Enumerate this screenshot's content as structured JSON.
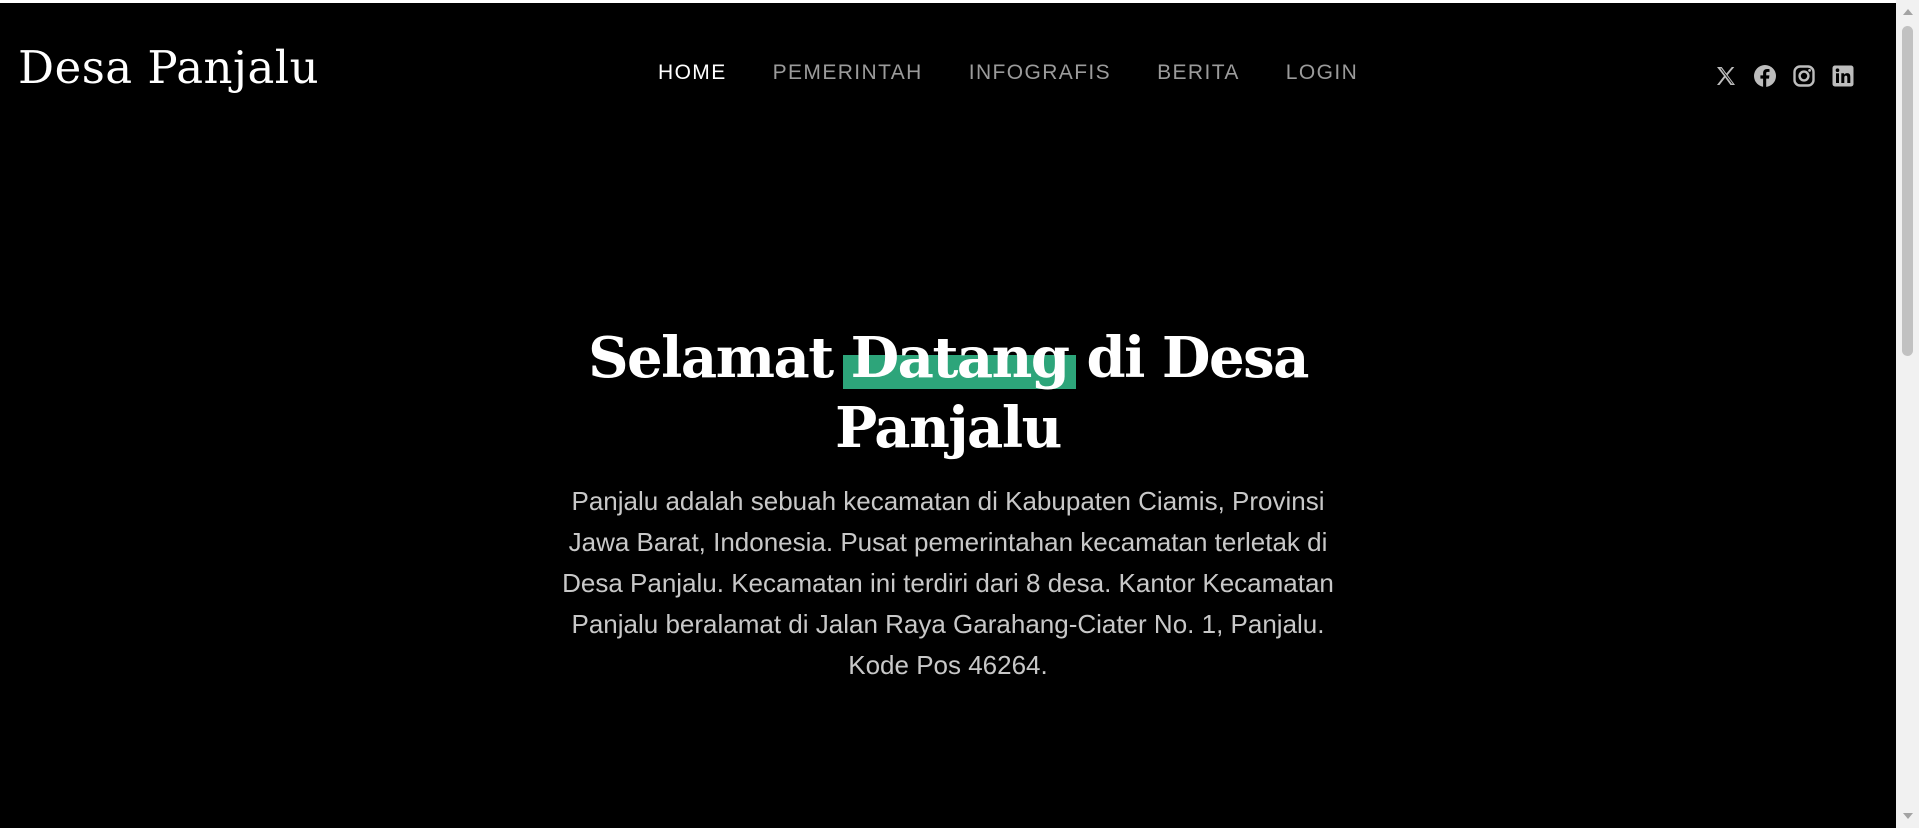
{
  "header": {
    "logo": "Desa Panjalu",
    "nav": [
      {
        "label": "HOME",
        "active": true
      },
      {
        "label": "PEMERINTAH",
        "active": false
      },
      {
        "label": "INFOGRAFIS",
        "active": false
      },
      {
        "label": "BERITA",
        "active": false
      },
      {
        "label": "LOGIN",
        "active": false
      }
    ],
    "socials": [
      "x-icon",
      "facebook-icon",
      "instagram-icon",
      "linkedin-icon"
    ]
  },
  "hero": {
    "title_before": "Selamat",
    "title_highlight": "Datang",
    "title_after": "di Desa Panjalu",
    "description": "Panjalu adalah sebuah kecamatan di Kabupaten Ciamis, Provinsi Jawa Barat, Indonesia. Pusat pemerintahan kecamatan terletak di Desa Panjalu. Kecamatan ini terdiri dari 8 desa. Kantor Kecamatan Panjalu beralamat di Jalan Raya Garahang-Ciater No. 1, Panjalu. Kode Pos 46264."
  },
  "colors": {
    "background": "#000000",
    "highlight": "#2da57a",
    "nav_inactive": "#9b9b9b",
    "text": "#ffffff"
  }
}
